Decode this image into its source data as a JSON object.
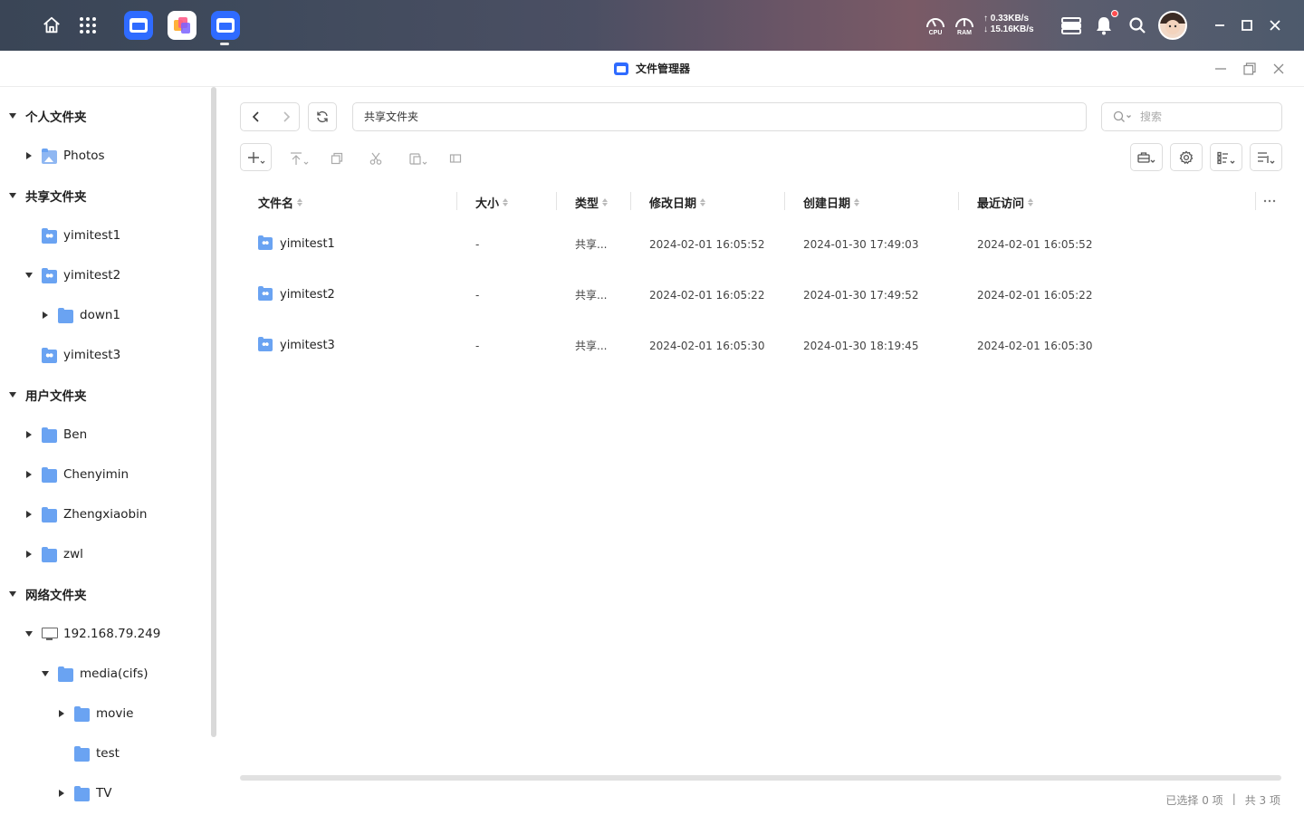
{
  "desktop": {
    "monitor": {
      "cpu_label": "CPU",
      "ram_label": "RAM"
    },
    "net": {
      "up": "↑ 0.33KB/s",
      "down": "↓ 15.16KB/s"
    }
  },
  "window": {
    "title": "文件管理器"
  },
  "sidebar": {
    "sections": {
      "personal": "个人文件夹",
      "shared": "共享文件夹",
      "users": "用户文件夹",
      "network": "网络文件夹"
    },
    "items": {
      "photos": "Photos",
      "yimitest1": "yimitest1",
      "yimitest2": "yimitest2",
      "down1": "down1",
      "yimitest3": "yimitest3",
      "ben": "Ben",
      "chenyimin": "Chenyimin",
      "zhengxiaobin": "Zhengxiaobin",
      "zwl": "zwl",
      "host": "192.168.79.249",
      "media": "media(cifs)",
      "movie": "movie",
      "test": "test",
      "tv": "TV"
    }
  },
  "toolbar": {
    "path": "共享文件夹",
    "search_placeholder": "搜索"
  },
  "table": {
    "columns": {
      "name": "文件名",
      "size": "大小",
      "type": "类型",
      "modified": "修改日期",
      "created": "创建日期",
      "accessed": "最近访问"
    },
    "rows": [
      {
        "name": "yimitest1",
        "size": "-",
        "type": "共享...",
        "modified": "2024-02-01 16:05:52",
        "created": "2024-01-30 17:49:03",
        "accessed": "2024-02-01 16:05:52"
      },
      {
        "name": "yimitest2",
        "size": "-",
        "type": "共享...",
        "modified": "2024-02-01 16:05:22",
        "created": "2024-01-30 17:49:52",
        "accessed": "2024-02-01 16:05:22"
      },
      {
        "name": "yimitest3",
        "size": "-",
        "type": "共享...",
        "modified": "2024-02-01 16:05:30",
        "created": "2024-01-30 18:19:45",
        "accessed": "2024-02-01 16:05:30"
      }
    ]
  },
  "status": {
    "selected": "已选择 0 项",
    "separator": "|",
    "total": "共 3 项"
  },
  "colors": {
    "accent": "#2f6bff",
    "folder": "#6aa3f2",
    "notification_dot": "#ff4d4f"
  }
}
